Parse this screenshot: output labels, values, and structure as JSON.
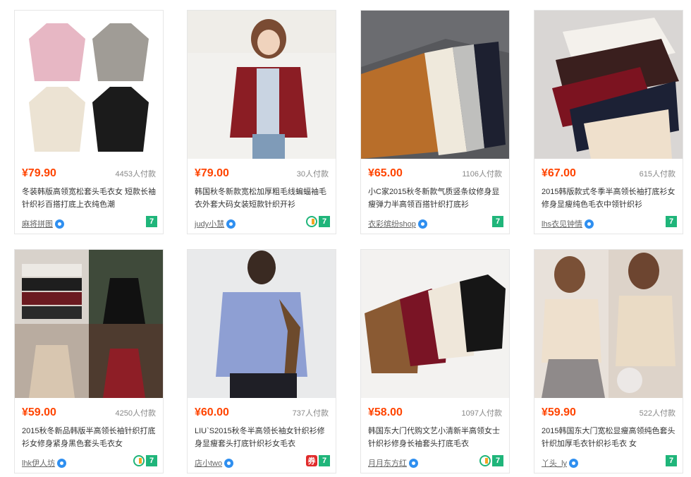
{
  "products": [
    {
      "price": "¥79.90",
      "sales": "4453人付款",
      "title": "冬装韩版高领宽松套头毛衣女 短款长袖针织衫百搭打底上衣纯色潮",
      "shop": "麻将拼图",
      "badges": [
        "tmall7"
      ]
    },
    {
      "price": "¥79.00",
      "sales": "30人付款",
      "title": "韩国秋冬新款宽松加厚粗毛线蝙蝠袖毛衣外套大码女装短款针织开衫",
      "shop": "judy小慧",
      "badges": [
        "circle",
        "tmall7"
      ]
    },
    {
      "price": "¥65.00",
      "sales": "1106人付款",
      "title": "小C家2015秋冬新款气质竖条纹修身显瘦弹力半高领百搭针织打底衫",
      "shop": "衣彩缤纷shop",
      "badges": [
        "tmall7"
      ]
    },
    {
      "price": "¥67.00",
      "sales": "615人付款",
      "title": "2015韩版款式冬季半高领长袖打底衫女修身显瘦纯色毛衣中领针织衫",
      "shop": "lhs衣见钟情",
      "badges": [
        "tmall7"
      ]
    },
    {
      "price": "¥59.00",
      "sales": "4250人付款",
      "title": "2015秋冬新品韩版半高领长袖针织打底衫女修身紧身黑色套头毛衣女",
      "shop": "lhk伊人坊",
      "badges": [
        "circle",
        "tmall7"
      ]
    },
    {
      "price": "¥60.00",
      "sales": "737人付款",
      "title": "LIU`S2015秋冬半高领长袖女针织衫修身显瘦套头打底针织衫女毛衣",
      "shop": "店小two",
      "badges": [
        "quan",
        "tmall7"
      ]
    },
    {
      "price": "¥58.00",
      "sales": "1097人付款",
      "title": "韩国东大门代购文艺小清新半高领女士针织衫修身长袖套头打底毛衣",
      "shop": "月月东方红",
      "badges": [
        "circle",
        "tmall7"
      ]
    },
    {
      "price": "¥59.90",
      "sales": "522人付款",
      "title": "2015韩国东大门宽松显瘦高领纯色套头针织加厚毛衣针织衫毛衣 女",
      "shop": "丫头_ly",
      "badges": [
        "tmall7"
      ]
    }
  ],
  "colors": {
    "price": "#ff4400",
    "tmall": "#1fb57a",
    "wangwang": "#2f8ff0"
  }
}
